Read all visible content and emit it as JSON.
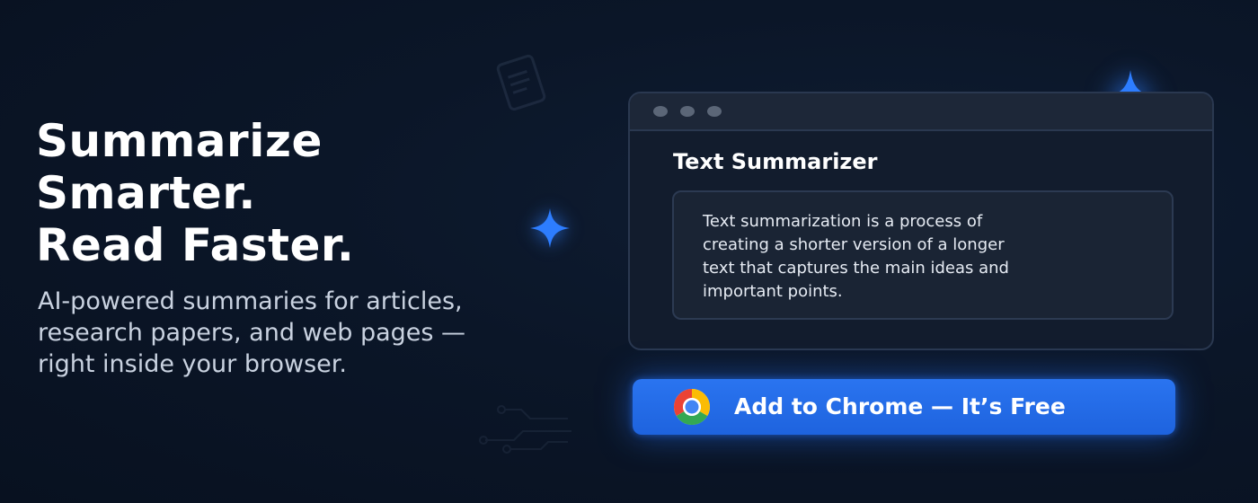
{
  "hero": {
    "headline": [
      "Summarize",
      "Smarter.",
      "Read Faster."
    ],
    "subheadline": [
      "AI-powered summaries for articles,",
      "research papers, and web pages —",
      "right inside your browser."
    ]
  },
  "preview": {
    "title": "Text Summarizer",
    "summary_lines": [
      "Text summarization is a process of",
      "creating a shorter version of a longer",
      "text that captures the main ideas and",
      "important points."
    ]
  },
  "cta": {
    "label": "Add to Chrome — It’s Free",
    "icon": "chrome-icon"
  },
  "icons": {
    "document": "document-icon",
    "circuit": "circuit-icon",
    "sparkle": "sparkle-icon"
  },
  "colors": {
    "background": "#0b1628",
    "accent": "#2a74f0",
    "sparkle": "#2d7dff",
    "panel": "#121c2d"
  }
}
